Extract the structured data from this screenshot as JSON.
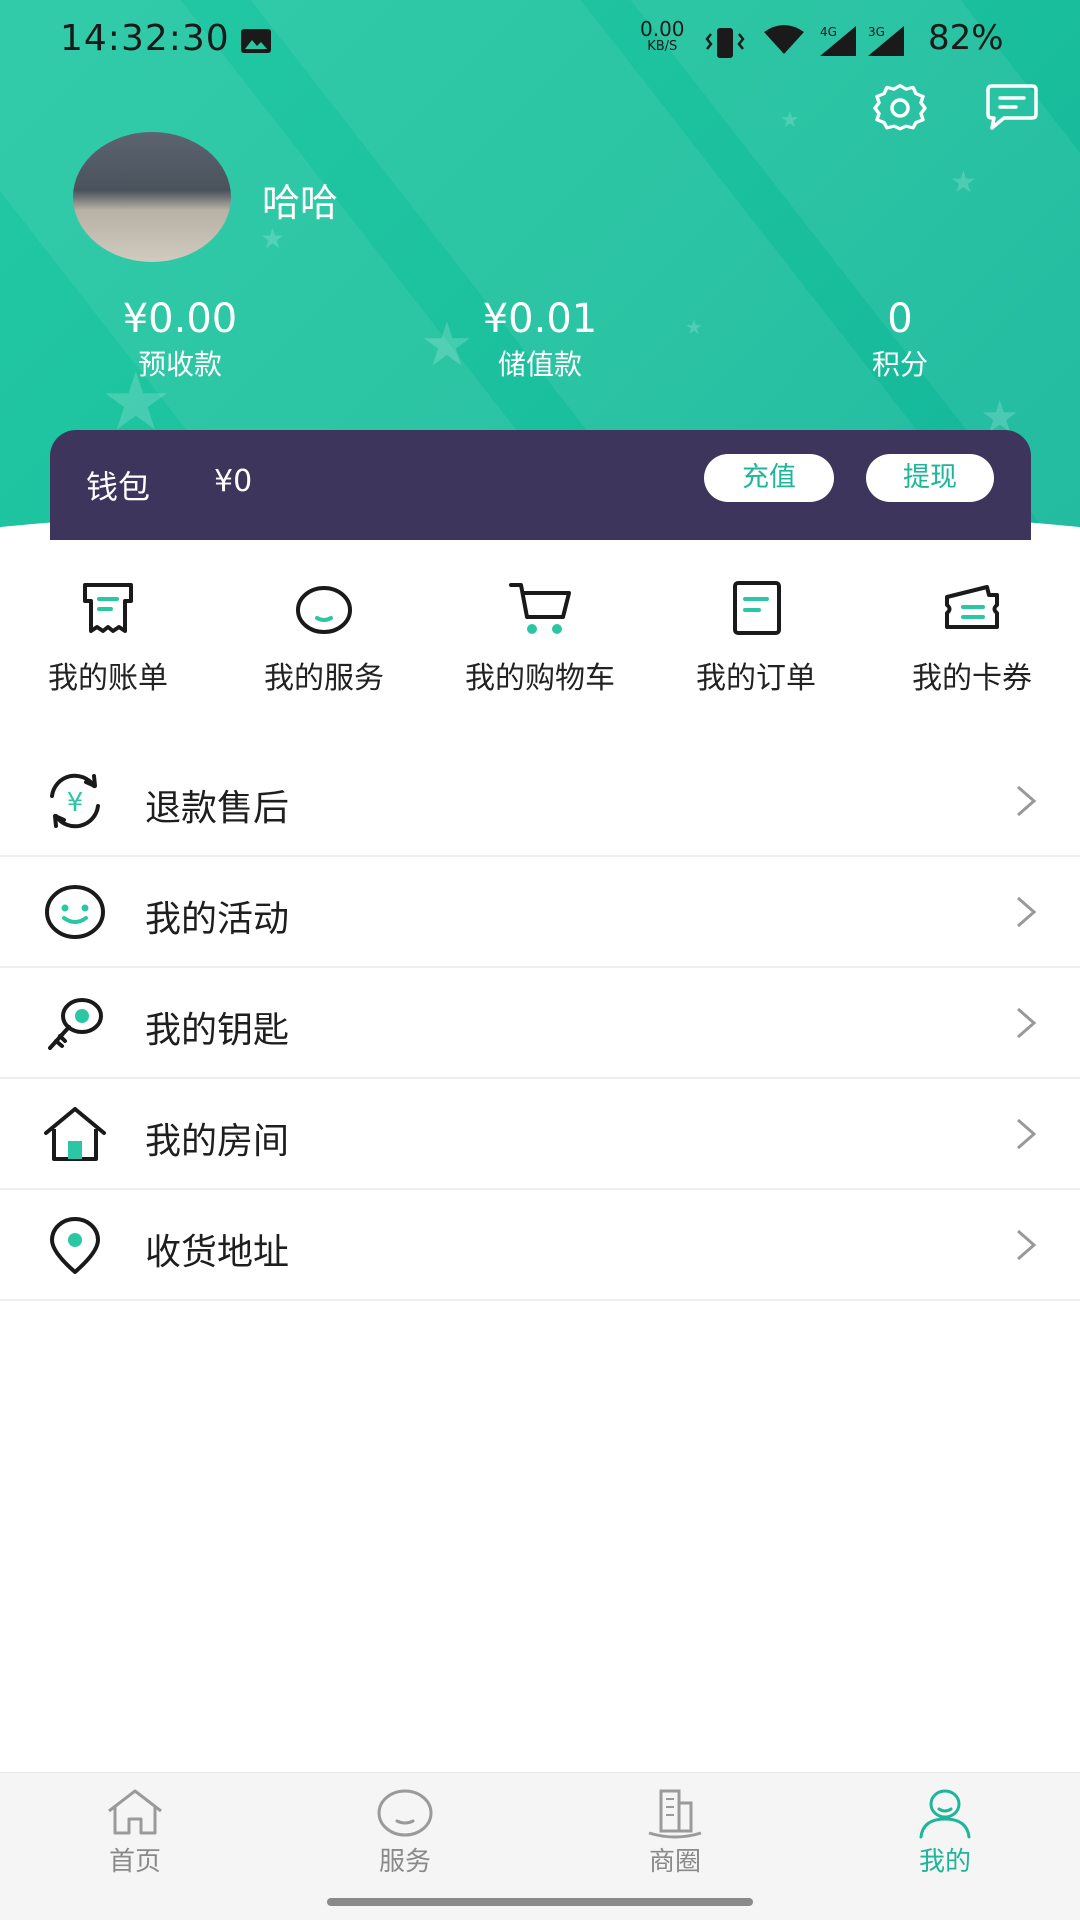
{
  "status_bar": {
    "time": "14:32:30",
    "net_speed": "0.00",
    "net_unit": "KB/S",
    "sig1_label": "4G",
    "sig2_label": "3G",
    "battery": "82%"
  },
  "header": {
    "username": "哈哈",
    "stats": [
      {
        "value": "¥0.00",
        "label": "预收款"
      },
      {
        "value": "¥0.01",
        "label": "储值款"
      },
      {
        "value": "0",
        "label": "积分"
      }
    ]
  },
  "wallet": {
    "label": "钱包",
    "amount": "¥0",
    "recharge_label": "充值",
    "withdraw_label": "提现"
  },
  "quick_actions": [
    {
      "label": "我的账单",
      "icon": "bill-icon"
    },
    {
      "label": "我的服务",
      "icon": "service-smile-icon"
    },
    {
      "label": "我的购物车",
      "icon": "cart-icon"
    },
    {
      "label": "我的订单",
      "icon": "order-icon"
    },
    {
      "label": "我的卡券",
      "icon": "coupon-icon"
    }
  ],
  "menu": [
    {
      "label": "退款售后",
      "icon": "refund-icon"
    },
    {
      "label": "我的活动",
      "icon": "activity-smile-icon"
    },
    {
      "label": "我的钥匙",
      "icon": "key-icon"
    },
    {
      "label": "我的房间",
      "icon": "house-icon"
    },
    {
      "label": "收货地址",
      "icon": "location-pin-icon"
    }
  ],
  "bottom_nav": [
    {
      "label": "首页",
      "icon": "home-icon",
      "active": false
    },
    {
      "label": "服务",
      "icon": "service-icon",
      "active": false
    },
    {
      "label": "商圈",
      "icon": "building-icon",
      "active": false
    },
    {
      "label": "我的",
      "icon": "profile-icon",
      "active": true
    }
  ],
  "colors": {
    "accent": "#1fb59a",
    "header_green": "#1cc19e",
    "wallet_bg": "#3e355c"
  }
}
